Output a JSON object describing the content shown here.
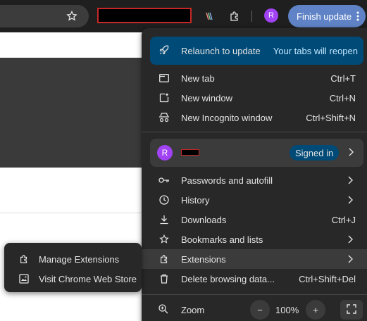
{
  "toolbar": {
    "avatar_initial": "R",
    "finish_update_label": "Finish update",
    "icons": [
      "star-icon",
      "color-extension-icon",
      "extensions-puzzle-icon",
      "more-vert-icon"
    ]
  },
  "menu": {
    "relaunch": {
      "label": "Relaunch to update",
      "note": "Your tabs will reopen"
    },
    "items_top": [
      {
        "label": "New tab",
        "shortcut": "Ctrl+T"
      },
      {
        "label": "New window",
        "shortcut": "Ctrl+N"
      },
      {
        "label": "New Incognito window",
        "shortcut": "Ctrl+Shift+N"
      }
    ],
    "profile": {
      "initial": "R",
      "status": "Signed in"
    },
    "items_mid": [
      {
        "label": "Passwords and autofill"
      },
      {
        "label": "History"
      },
      {
        "label": "Downloads",
        "shortcut": "Ctrl+J"
      },
      {
        "label": "Bookmarks and lists"
      },
      {
        "label": "Extensions"
      },
      {
        "label": "Delete browsing data...",
        "shortcut": "Ctrl+Shift+Del"
      }
    ],
    "zoom": {
      "label": "Zoom",
      "value": "100%",
      "minus": "−",
      "plus": "+"
    }
  },
  "submenu": {
    "items": [
      {
        "label": "Manage Extensions"
      },
      {
        "label": "Visit Chrome Web Store"
      }
    ]
  },
  "colors": {
    "accent": "#004a77",
    "finish_update": "#5f83c6",
    "avatar": "#a142f4"
  }
}
